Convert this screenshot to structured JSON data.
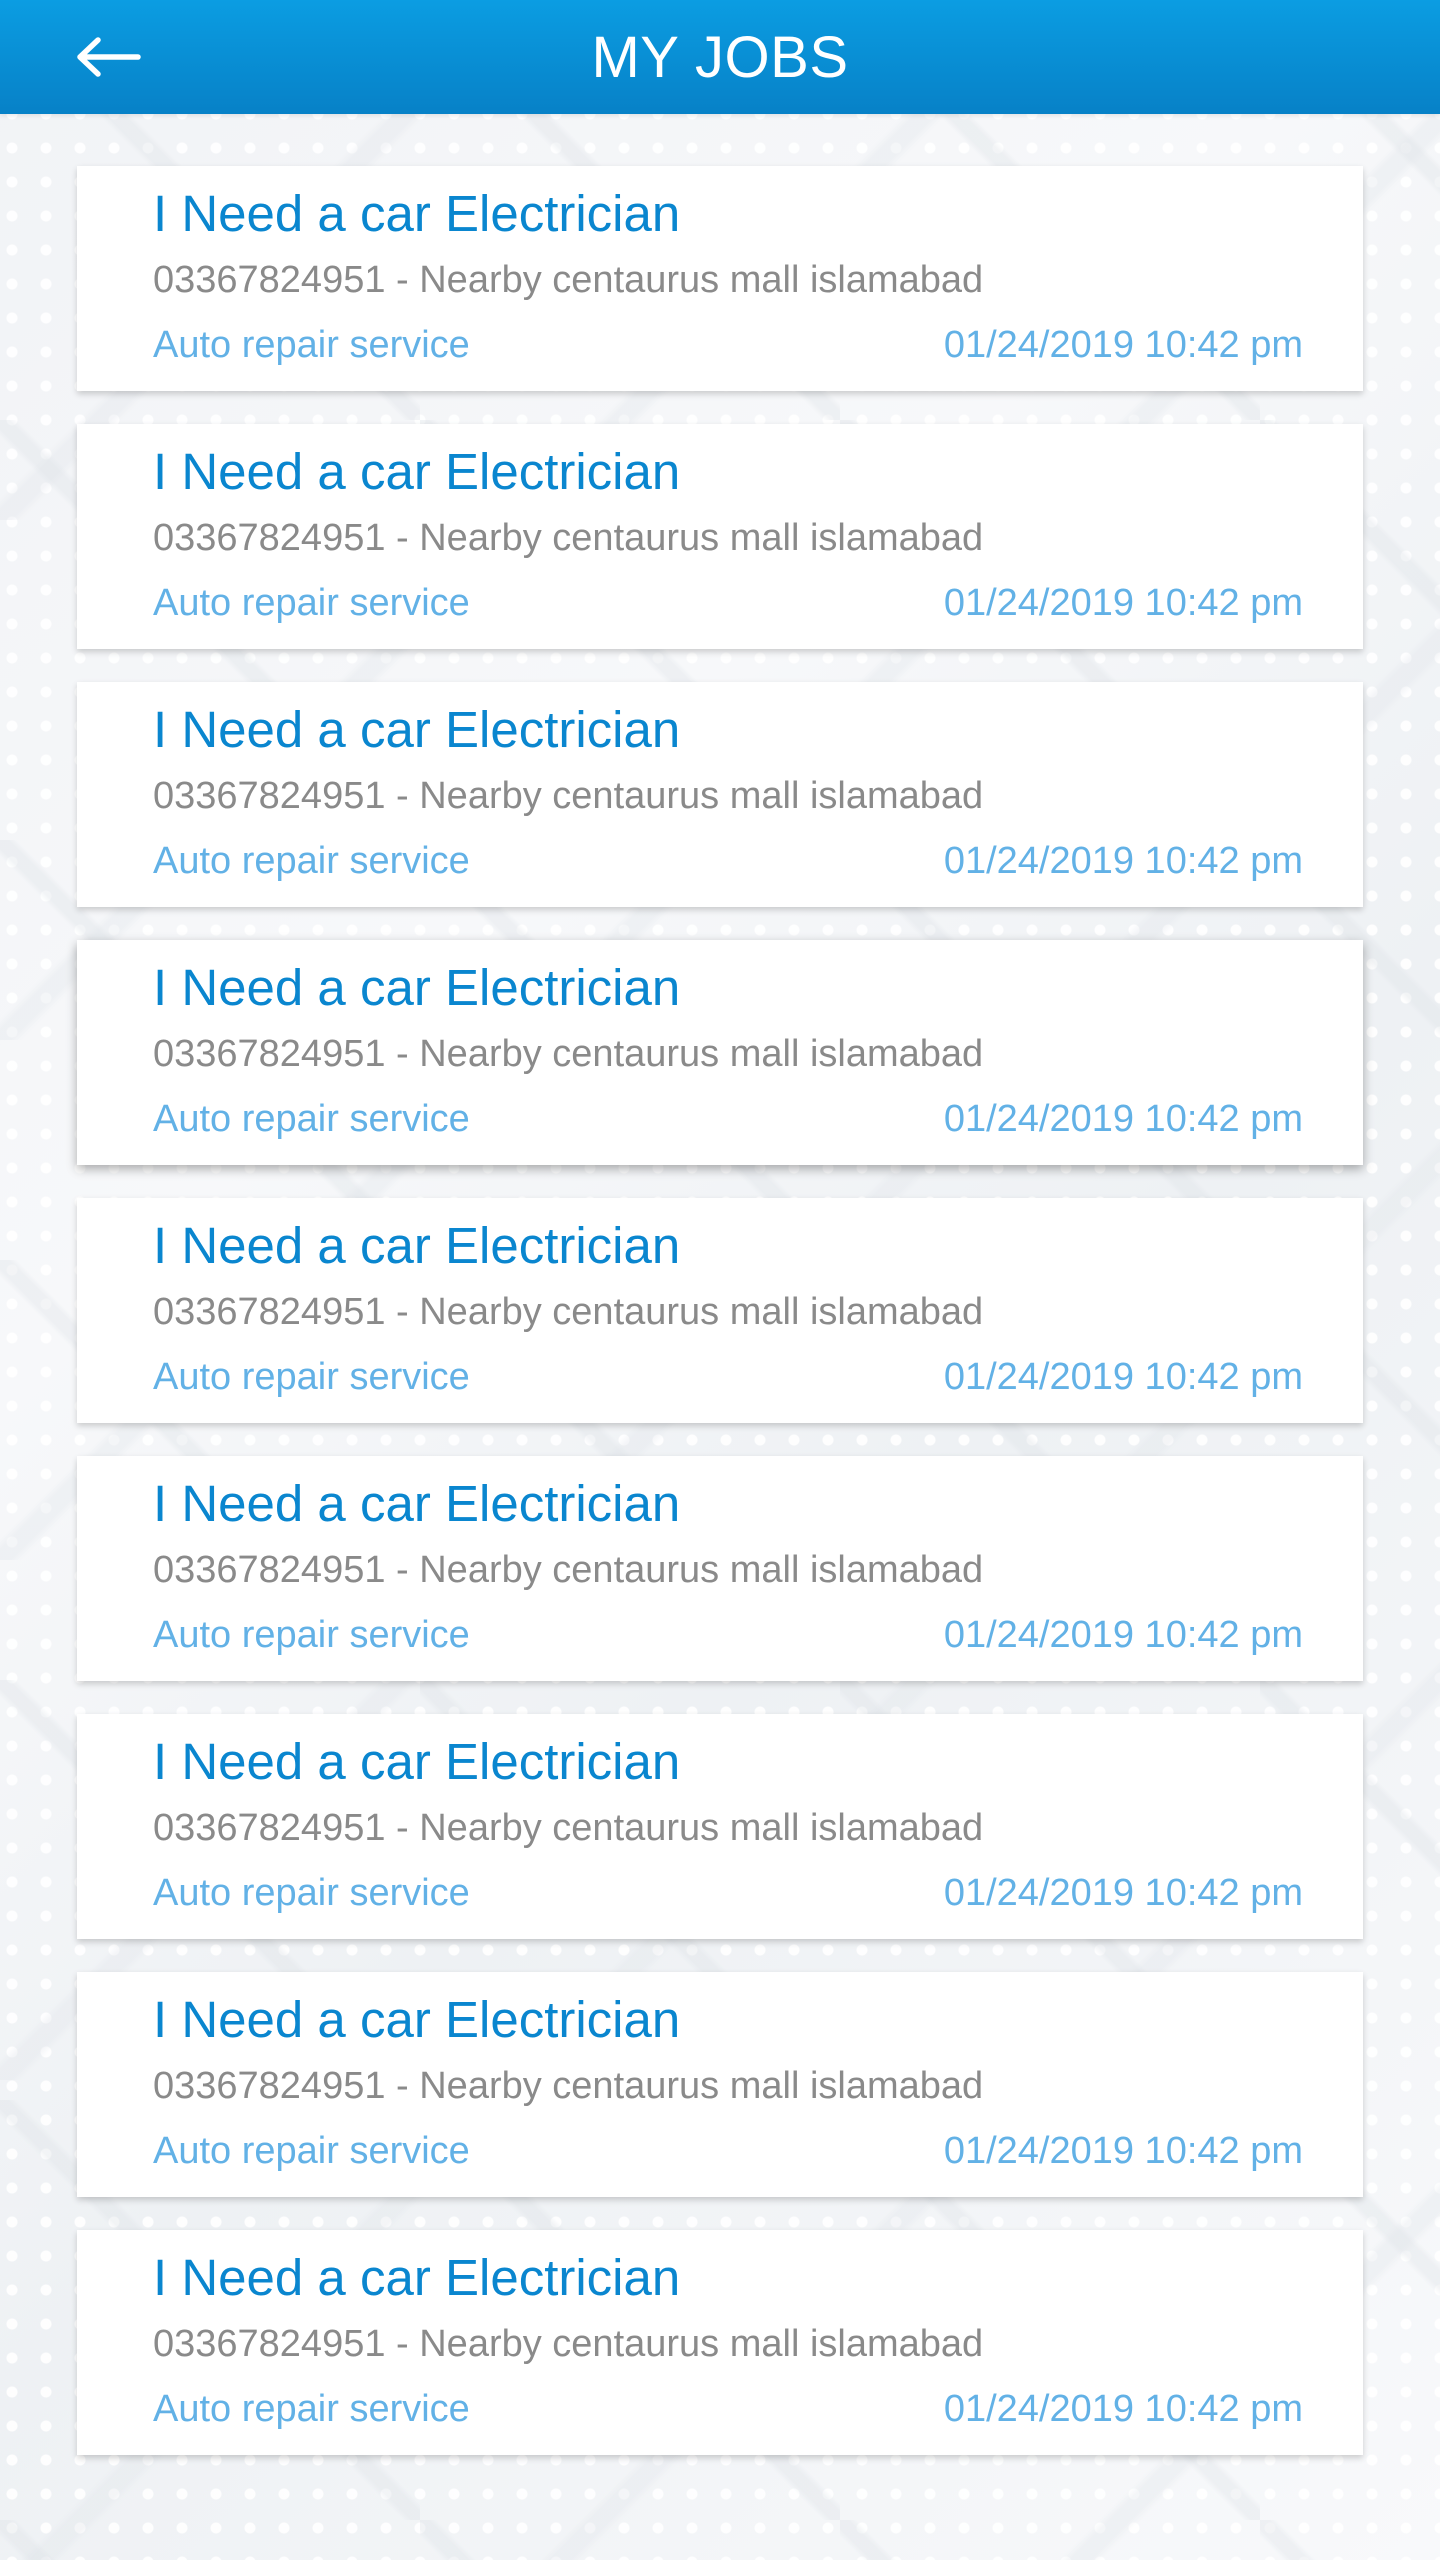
{
  "header": {
    "title": "MY JOBS",
    "back_icon": "arrow-left-icon"
  },
  "colors": {
    "header_gradient_top": "#0b9de2",
    "header_gradient_bottom": "#0781c7",
    "job_title": "#0a86cf",
    "details_text": "#8a8a8a",
    "meta_text": "#62b1e6"
  },
  "jobs": [
    {
      "title": "I Need a car Electrician",
      "details": "03367824951 - Nearby centaurus mall islamabad",
      "service": "Auto repair service",
      "datetime": "01/24/2019  10:42 pm"
    },
    {
      "title": "I Need a car Electrician",
      "details": "03367824951 - Nearby centaurus mall islamabad",
      "service": "Auto repair service",
      "datetime": "01/24/2019  10:42 pm"
    },
    {
      "title": "I Need a car Electrician",
      "details": "03367824951 - Nearby centaurus mall islamabad",
      "service": "Auto repair service",
      "datetime": "01/24/2019  10:42 pm"
    },
    {
      "title": "I Need a car Electrician",
      "details": "03367824951 - Nearby centaurus mall islamabad",
      "service": "Auto repair service",
      "datetime": "01/24/2019  10:42 pm"
    },
    {
      "title": "I Need a car Electrician",
      "details": "03367824951 - Nearby centaurus mall islamabad",
      "service": "Auto repair service",
      "datetime": "01/24/2019  10:42 pm"
    },
    {
      "title": "I Need a car Electrician",
      "details": "03367824951 - Nearby centaurus mall islamabad",
      "service": "Auto repair service",
      "datetime": "01/24/2019  10:42 pm"
    },
    {
      "title": "I Need a car Electrician",
      "details": "03367824951 - Nearby centaurus mall islamabad",
      "service": "Auto repair service",
      "datetime": "01/24/2019  10:42 pm"
    },
    {
      "title": "I Need a car Electrician",
      "details": "03367824951 - Nearby centaurus mall islamabad",
      "service": "Auto repair service",
      "datetime": "01/24/2019  10:42 pm"
    },
    {
      "title": "I Need a car Electrician",
      "details": "03367824951 - Nearby centaurus mall islamabad",
      "service": "Auto repair service",
      "datetime": "01/24/2019  10:42 pm"
    }
  ]
}
